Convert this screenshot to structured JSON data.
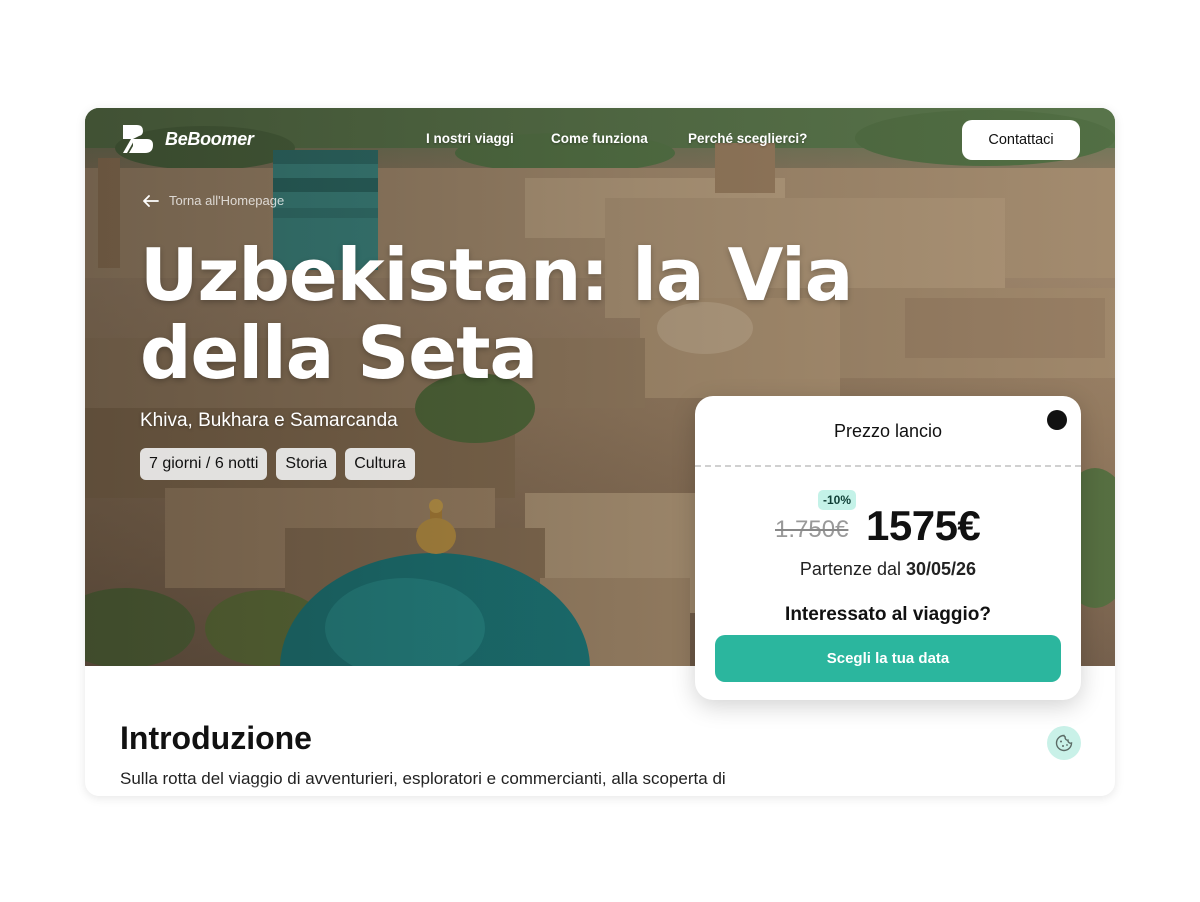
{
  "brand": {
    "name": "BeBoomer",
    "logo_icon": "bb-monogram-icon"
  },
  "nav": {
    "links": [
      "I nostri viaggi",
      "Come funziona",
      "Perché sceglierci?"
    ],
    "contact_label": "Contattaci"
  },
  "hero": {
    "back_label": "Torna all'Homepage",
    "title": "Uzbekistan: la Via della Seta",
    "subtitle": "Khiva, Bukhara e Samarcanda",
    "tags": [
      "7 giorni  / 6 notti",
      "Storia",
      "Cultura"
    ]
  },
  "price_card": {
    "title": "Prezzo lancio",
    "discount": "-10%",
    "old_price": "1.750€",
    "new_price": "1575€",
    "departures_prefix": "Partenze dal",
    "departures_date": "30/05/26",
    "question": "Interessato al viaggio?",
    "cta_label": "Scegli la tua data"
  },
  "intro": {
    "heading": "Introduzione",
    "text": "Sulla rotta del viaggio di avventurieri, esploratori e commercianti, alla scoperta di"
  },
  "colors": {
    "accent": "#2bb69e",
    "badge_bg": "#c4f2e8",
    "cookie_bg": "#c9f1e8"
  },
  "icons": {
    "back": "arrow-left-icon",
    "cookie": "cookie-icon"
  }
}
